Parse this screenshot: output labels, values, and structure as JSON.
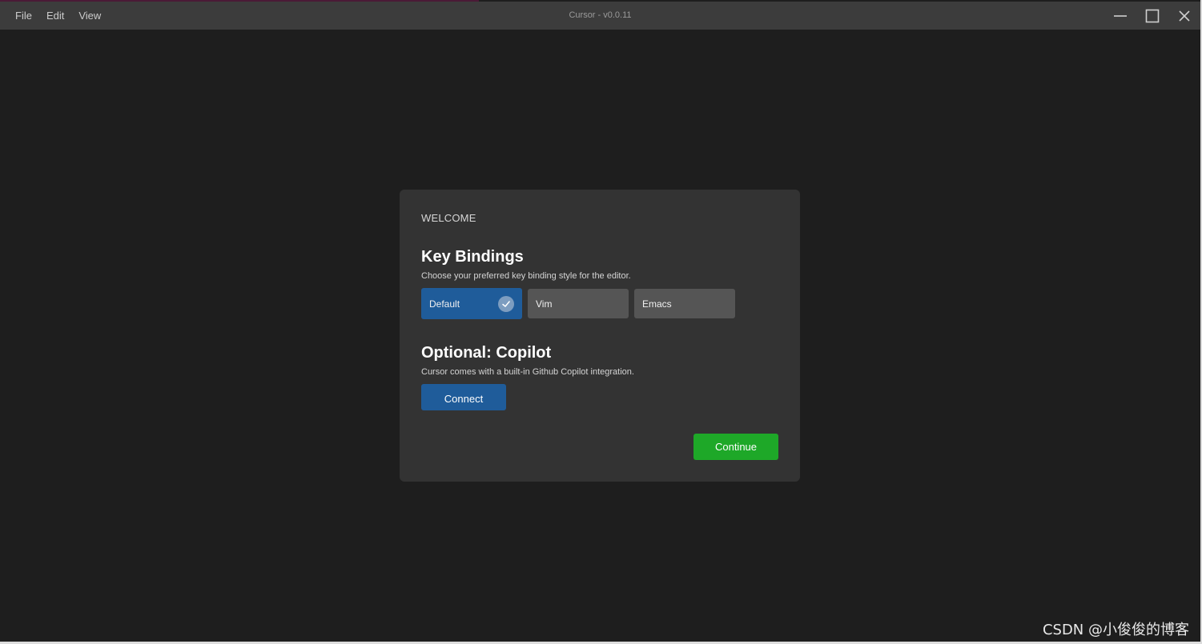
{
  "window": {
    "title": "Cursor - v0.0.11",
    "menu": [
      "File",
      "Edit",
      "View"
    ],
    "controls": [
      "minimize-icon",
      "maximize-icon",
      "close-icon"
    ]
  },
  "dialog": {
    "eyebrow": "WELCOME",
    "key_bindings": {
      "heading": "Key Bindings",
      "description": "Choose your preferred key binding style for the editor.",
      "options": [
        "Default",
        "Vim",
        "Emacs"
      ],
      "selected": "Default"
    },
    "copilot": {
      "heading": "Optional: Copilot",
      "description": "Cursor comes with a built-in Github Copilot integration.",
      "connect_label": "Connect"
    },
    "continue_label": "Continue"
  },
  "watermark": "CSDN @小俊俊的博客",
  "colors": {
    "background": "#1e1e1e",
    "titlebar": "#3c3c3c",
    "dialog": "#333333",
    "accent_blue": "#1f5c9a",
    "option_bg": "#555555",
    "continue_green": "#1ea828"
  }
}
